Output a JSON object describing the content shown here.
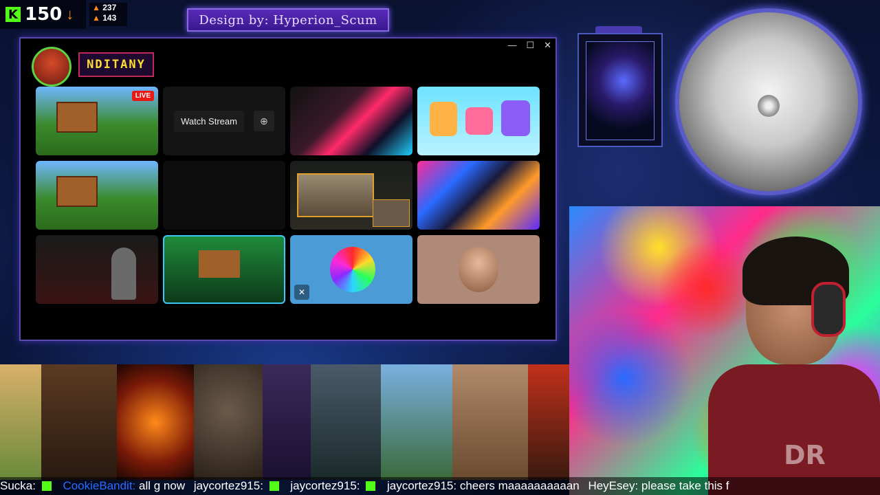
{
  "stats": {
    "kick_count": "150",
    "viewers_a": "237",
    "viewers_b": "143"
  },
  "banner": {
    "text": "Design by: Hyperion_Scum"
  },
  "window": {
    "controls": [
      "—",
      "☐",
      "✕"
    ],
    "channel_name": "NDITANY",
    "tiles": [
      {
        "live": "LIVE"
      },
      {
        "watch_label": "Watch Stream"
      },
      {},
      {},
      {},
      {},
      {},
      {},
      {},
      {},
      {},
      {}
    ]
  },
  "chat": {
    "messages": [
      {
        "user": "",
        "text": "Sucka: "
      },
      {
        "user": "CookieBandit:",
        "text": " all g now "
      },
      {
        "user": "",
        "text": "jaycortez915: "
      },
      {
        "user": "",
        "text": "jaycortez915: "
      },
      {
        "user": "",
        "text": "jaycortez915: cheers maaaaaaaaaan "
      },
      {
        "user": "",
        "text": "HeyEsey: please take this f"
      }
    ]
  },
  "webcam": {
    "shirt_text": "DR"
  }
}
